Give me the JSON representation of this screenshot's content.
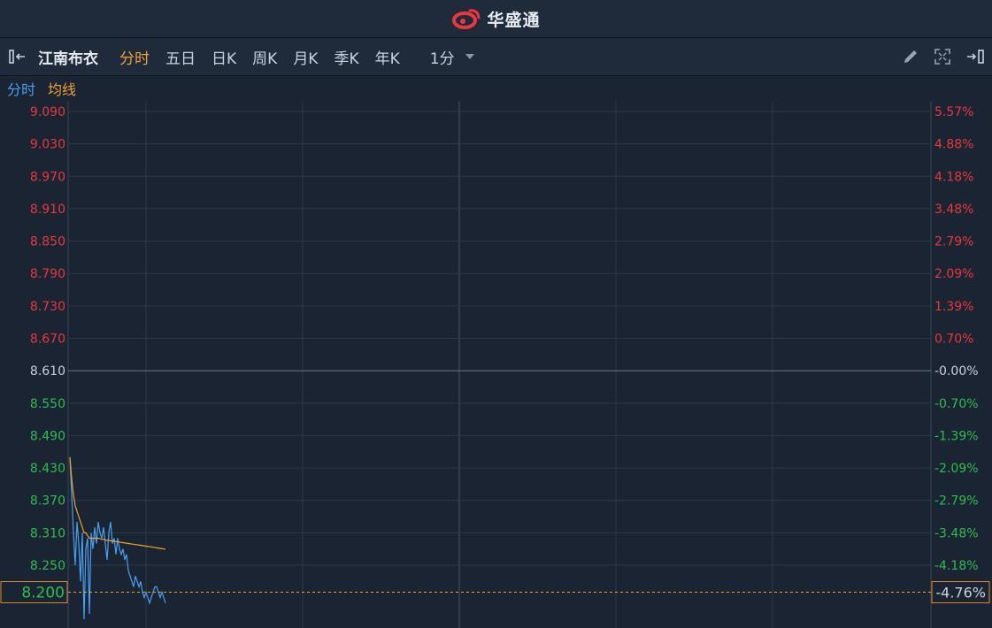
{
  "header": {
    "brand_name": "华盛通"
  },
  "toolbar": {
    "stock_name": "江南布衣",
    "tabs": [
      {
        "label": "分时",
        "active": true
      },
      {
        "label": "五日",
        "active": false
      },
      {
        "label": "日K",
        "active": false
      },
      {
        "label": "周K",
        "active": false
      },
      {
        "label": "月K",
        "active": false
      },
      {
        "label": "季K",
        "active": false
      },
      {
        "label": "年K",
        "active": false
      }
    ],
    "interval": "1分",
    "icons": [
      "collapse-left-icon",
      "pencil-icon",
      "fullscreen-icon",
      "expand-right-icon"
    ]
  },
  "legend": {
    "time_share": "分时",
    "average": "均线"
  },
  "colors": {
    "background": "#1b2433",
    "up": "#e8383d",
    "down": "#2ebd4e",
    "neutral": "#c9d1dd",
    "price_line": "#4a9ff0",
    "avg_line": "#f0a233",
    "grid": "#2c3849"
  },
  "chart_data": {
    "type": "line",
    "reference_price": 8.61,
    "ylim": [
      8.17,
      9.11
    ],
    "price_ticks": [
      "9.090",
      "9.030",
      "8.970",
      "8.910",
      "8.850",
      "8.790",
      "8.730",
      "8.670",
      "8.610",
      "8.550",
      "8.490",
      "8.430",
      "8.370",
      "8.310",
      "8.250"
    ],
    "percent_ticks": [
      "5.57%",
      "4.88%",
      "4.18%",
      "3.48%",
      "2.79%",
      "2.09%",
      "1.39%",
      "0.70%",
      "-0.00%",
      "-0.70%",
      "-1.39%",
      "-2.09%",
      "-2.79%",
      "-3.48%",
      "-4.18%"
    ],
    "current_price_label": "8.200",
    "current_percent_label": "-4.76%",
    "current_price": 8.2,
    "series": [
      {
        "name": "分时",
        "values": [
          8.45,
          8.38,
          8.31,
          8.25,
          8.33,
          8.29,
          8.22,
          8.31,
          8.15,
          8.28,
          8.3,
          8.16,
          8.31,
          8.28,
          8.32,
          8.29,
          8.33,
          8.31,
          8.3,
          8.32,
          8.29,
          8.26,
          8.31,
          8.33,
          8.29,
          8.3,
          8.27,
          8.3,
          8.28,
          8.27,
          8.28,
          8.26,
          8.27,
          8.24,
          8.23,
          8.22,
          8.21,
          8.23,
          8.22,
          8.21,
          8.22,
          8.2,
          8.19,
          8.2,
          8.19,
          8.18,
          8.19,
          8.2,
          8.21,
          8.21,
          8.2,
          8.19,
          8.2,
          8.19,
          8.18
        ]
      },
      {
        "name": "均线",
        "values": [
          8.45,
          8.41,
          8.38,
          8.36,
          8.35,
          8.34,
          8.33,
          8.32,
          8.31,
          8.31,
          8.305,
          8.3,
          8.3,
          8.3,
          8.3,
          8.3,
          8.3,
          8.299,
          8.298,
          8.298,
          8.297,
          8.296,
          8.296,
          8.295,
          8.295,
          8.294,
          8.294,
          8.293,
          8.293,
          8.292,
          8.292,
          8.291,
          8.291,
          8.29,
          8.29,
          8.289,
          8.289,
          8.288,
          8.288,
          8.287,
          8.287,
          8.286,
          8.286,
          8.285,
          8.285,
          8.284,
          8.284,
          8.283,
          8.283,
          8.282,
          8.282,
          8.281,
          8.281,
          8.28,
          8.28
        ]
      }
    ]
  }
}
